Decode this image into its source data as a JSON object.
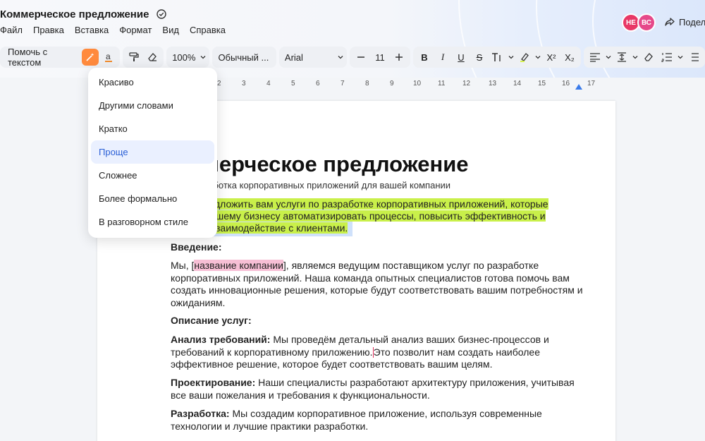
{
  "header": {
    "doc_title": "Коммерческое предложение",
    "menu": [
      "Файл",
      "Правка",
      "Вставка",
      "Формат",
      "Вид",
      "Справка"
    ],
    "avatars": [
      {
        "initials": "НЕ",
        "color": "#e83866"
      },
      {
        "initials": "ВС",
        "color": "#e6498a"
      }
    ],
    "share_label": "Подел"
  },
  "toolbar": {
    "help_text": "Помочь с текстом",
    "zoom": "100%",
    "style": "Обычный ...",
    "font": "Arial",
    "font_size": "11",
    "bold": "B",
    "italic": "I",
    "underline": "U",
    "strike": "S",
    "superscript": "X²",
    "subscript": "X₂"
  },
  "ruler": {
    "ticks": [
      "2",
      "3",
      "4",
      "5",
      "6",
      "7",
      "8",
      "9",
      "10",
      "11",
      "12",
      "13",
      "14",
      "15",
      "16",
      "17"
    ]
  },
  "dropdown": {
    "items": [
      "Красиво",
      "Другими словами",
      "Кратко",
      "Проще",
      "Сложнее",
      "Более формально",
      "В разговорном стиле"
    ],
    "active_index": 3
  },
  "document": {
    "title": "мерческое предложение",
    "subtitle": "работка корпоративных приложений для вашей компании",
    "highlight_lines": [
      "дложить вам услуги по разработке корпоративных приложений, которые",
      "шему бизнесу автоматизировать процессы, повысить эффективность и",
      "заимодействие с клиентами."
    ],
    "intro_heading": "Введение:",
    "intro_l1_pre": "Мы, [",
    "intro_l1_hl": "название компании",
    "intro_l1_post": "], являемся ведущим поставщиком услуг по разработке",
    "intro_l2": "корпоративных приложений. Наша команда опытных специалистов готова помочь вам",
    "intro_l3": "создать инновационные решения, которые будут соответствовать вашим потребностям и",
    "intro_l4": "ожиданиям.",
    "services_heading": "Описание услуг:",
    "s1_bold": "Анализ требований:",
    "s1_l1": " Мы проведём детальный анализ ваших бизнес-процессов и",
    "s1_l2_pre": "требований к корпоративному приложению.",
    "s1_l2_post": "Это позволит нам создать наиболее",
    "s1_l3": "эффективное решение, которое будет соответствовать вашим целям.",
    "s2_bold": "Проектирование:",
    "s2_l1": " Наши специалисты разработают архитектуру приложения, учитывая",
    "s2_l2": "все ваши пожелания и требования к функциональности.",
    "s3_bold": "Разработка:",
    "s3_l1": " Мы создадим корпоративное приложение, используя современные",
    "s3_l2": "технологии и лучшие практики разработки."
  }
}
